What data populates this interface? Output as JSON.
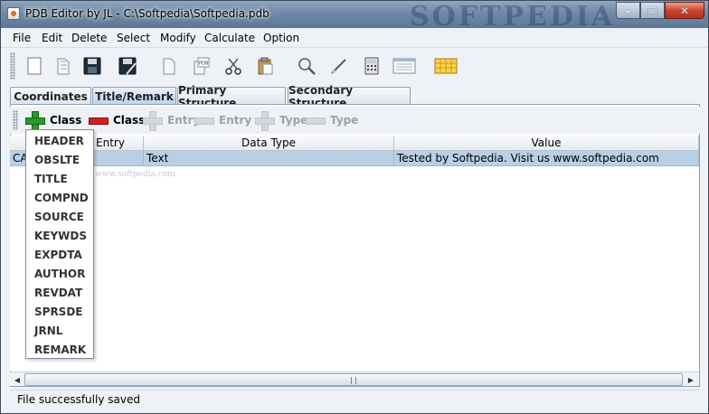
{
  "window": {
    "title": "PDB Editor by JL - C:\\Softpedia\\Softpedia.pdb",
    "watermark": "SOFTPEDIA"
  },
  "window_buttons": {
    "minimize": "–",
    "maximize": "□",
    "close": "✕"
  },
  "menu": [
    {
      "label": "File"
    },
    {
      "label": "Edit"
    },
    {
      "label": "Delete"
    },
    {
      "label": "Select"
    },
    {
      "label": "Modify"
    },
    {
      "label": "Calculate"
    },
    {
      "label": "Option"
    }
  ],
  "toolbar_icons": [
    "new-document-icon",
    "open-icon",
    "save-icon",
    "save-as-icon",
    "blank-page-icon",
    "pdb-file-icon",
    "cut-icon",
    "paste-icon",
    "search-icon",
    "pen-icon",
    "calculator-icon",
    "table-view-icon",
    "grid-icon"
  ],
  "tabs": [
    {
      "label": "Coordinates",
      "active": false
    },
    {
      "label": "Title/Remark",
      "active": true
    },
    {
      "label": "Primary Structure",
      "active": false
    },
    {
      "label": "Secondary Structure",
      "active": false
    }
  ],
  "subtoolbar": {
    "add_class": "Class",
    "remove_class": "Class",
    "add_entry": "Entry",
    "remove_entry": "Entry",
    "add_type": "Type",
    "remove_type": "Type"
  },
  "table": {
    "columns": [
      "",
      "Entry",
      "Data Type",
      "Value"
    ],
    "rows": [
      {
        "class": "CA",
        "entry": "",
        "data_type": "Text",
        "value": "Tested by Softpedia. Visit us www.softpedia.com"
      }
    ],
    "watermark": "www.softpedia.com"
  },
  "dropdown": {
    "items": [
      "HEADER",
      "OBSLTE",
      "TITLE",
      "COMPND",
      "SOURCE",
      "KEYWDS",
      "EXPDTA",
      "AUTHOR",
      "REVDAT",
      "SPRSDE",
      "JRNL",
      "REMARK"
    ]
  },
  "status": {
    "text": "File successfully saved"
  },
  "colors": {
    "selected_row": "#b8cfe5",
    "add_green": "#2a9a2a",
    "remove_red": "#d02020"
  }
}
